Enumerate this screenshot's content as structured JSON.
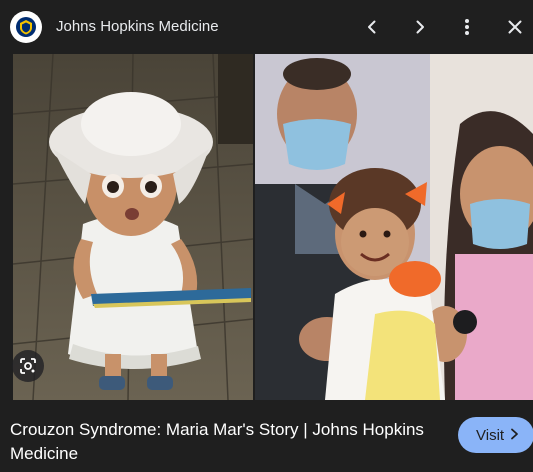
{
  "header": {
    "site_name": "Johns Hopkins Medicine",
    "icons": [
      "site-shield-logo",
      "chevron-left-icon",
      "chevron-right-icon",
      "more-vert-icon",
      "close-icon"
    ]
  },
  "image": {
    "left_photo": "toddler in white sun hat and white dress holding a book",
    "right_photo": "smiling toddler with orange bows held by two adults in face masks",
    "lens_icon": "lens-search-icon"
  },
  "caption": {
    "title": "Crouzon Syndrome: Maria Mar's Story | Johns Hopkins Medicine"
  },
  "actions": {
    "visit_label": "Visit",
    "visit_icon": "chevron-right-icon"
  },
  "colors": {
    "background": "#1f1f1f",
    "text": "#e8eaed",
    "visit_bg": "#8ab4f8"
  }
}
